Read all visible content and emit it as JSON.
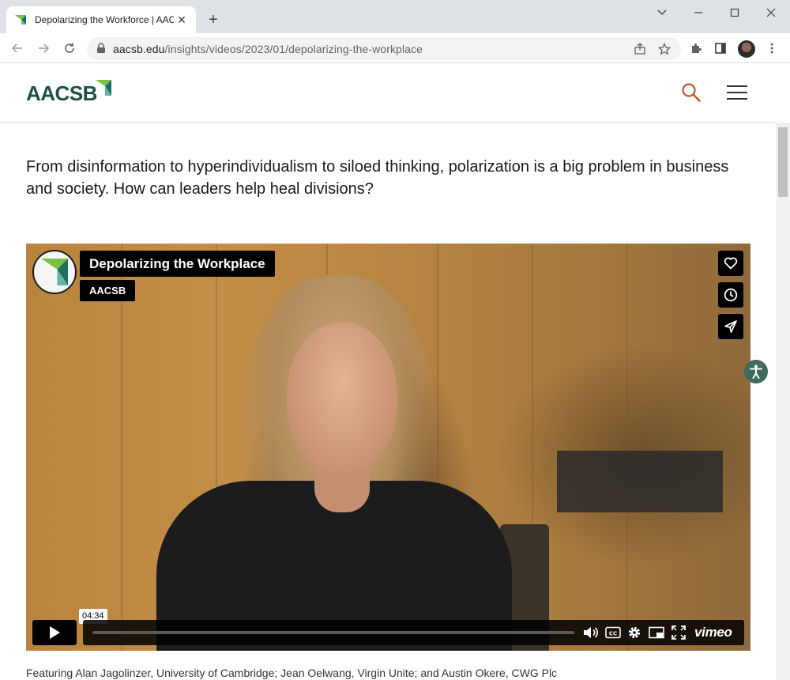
{
  "browser": {
    "tab_title": "Depolarizing the Workforce | AACSB",
    "url_domain": "aacsb.edu",
    "url_path": "/insights/videos/2023/01/depolarizing-the-workplace"
  },
  "site": {
    "logo_text": "AACSB",
    "brand_color": "#1f4f45",
    "accent_color": "#c0542a"
  },
  "article": {
    "intro": "From disinformation to hyperindividualism to siloed thinking, polarization is a big problem in business and society. How can leaders help heal divisions?",
    "caption": "Featuring Alan Jagolinzer, University of Cambridge; Jean Oelwang, Virgin Unite; and Austin Okere, CWG Plc"
  },
  "video": {
    "title": "Depolarizing the Workplace",
    "byline": "AACSB",
    "duration": "04:34",
    "progress_fraction": 0.0,
    "brand": "vimeo"
  },
  "icons": {
    "side_actions": [
      "heart-icon",
      "clock-icon",
      "send-icon"
    ],
    "controls": [
      "volume-icon",
      "cc-icon",
      "settings-icon",
      "pip-icon",
      "fullscreen-icon"
    ]
  }
}
